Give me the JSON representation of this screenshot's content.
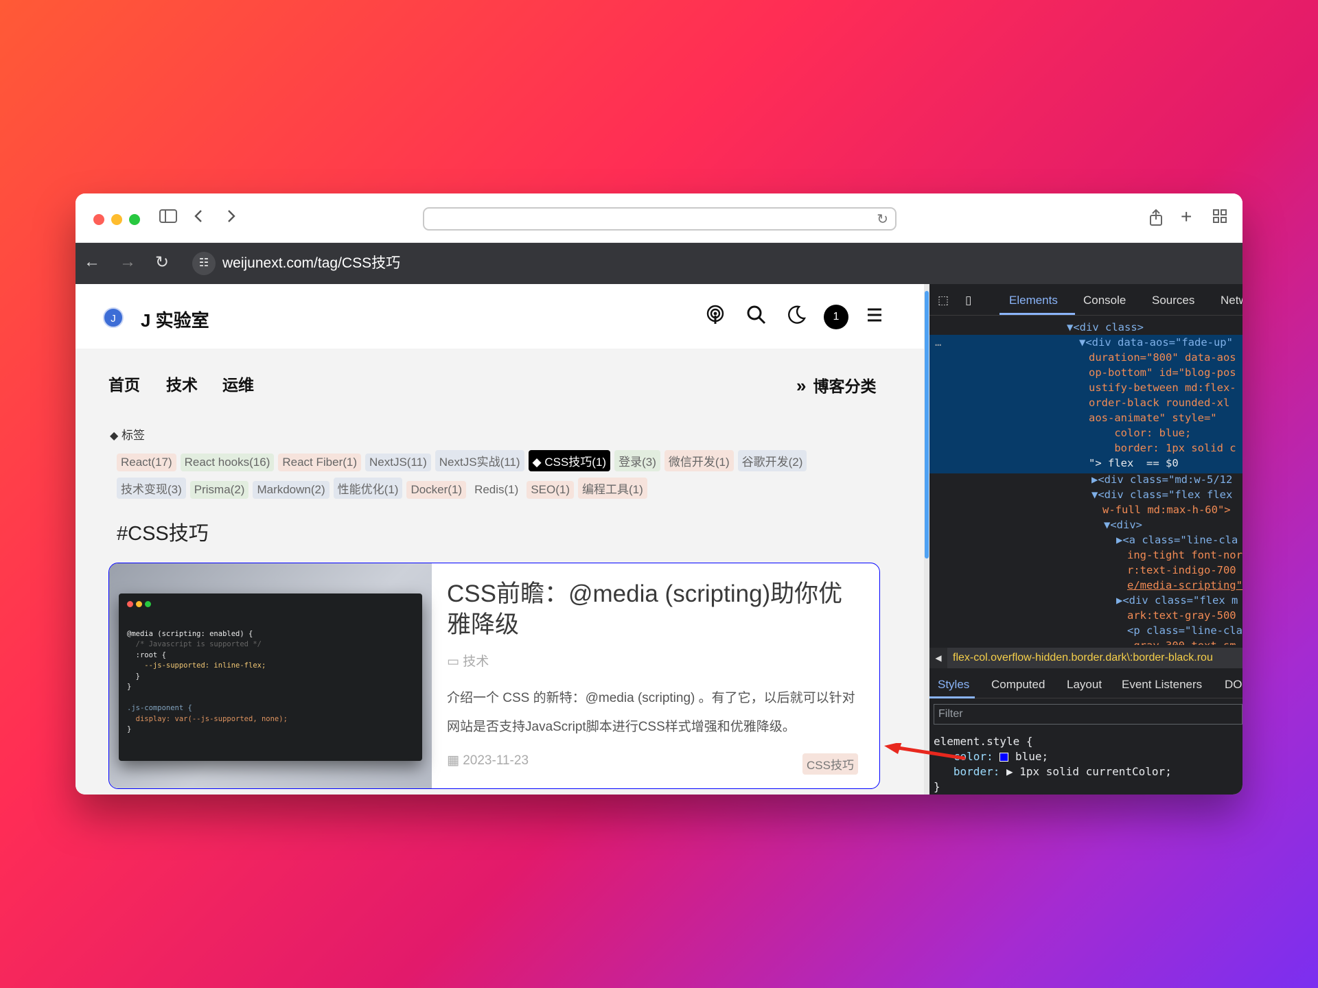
{
  "browser": {
    "url": "weijunext.com/tag/CSS技巧"
  },
  "site": {
    "logo_letter": "J",
    "title": "J 实验室",
    "badge": "1",
    "menu": [
      "首页",
      "技术",
      "运维"
    ],
    "category_link": "博客分类",
    "tag_label": "标签",
    "tags": [
      "React(17)",
      "React hooks(16)",
      "React Fiber(1)",
      "NextJS(11)",
      "NextJS实战(11)",
      "CSS技巧(1)",
      "登录(3)",
      "微信开发(1)",
      "谷歌开发(2)",
      "技术变现(3)",
      "Prisma(2)",
      "Markdown(2)",
      "性能优化(1)",
      "Docker(1)",
      "Redis(1)",
      "SEO(1)",
      "编程工具(1)"
    ],
    "active_tag": "CSS技巧(1)",
    "tag_heading": "#CSS技巧"
  },
  "post": {
    "title": "CSS前瞻：@media (scripting)助你优雅降级",
    "category": "技术",
    "description": "介绍一个 CSS 的新特：@media (scripting) 。有了它，以后就可以针对网站是否支持JavaScript脚本进行CSS样式增强和优雅降级。",
    "date": "2023-11-23",
    "tag": "CSS技巧",
    "code_lines": [
      "@media (scripting: enabled) {",
      "  /* Javascript is supported */",
      "  :root {",
      "    --js-supported: inline-flex;",
      "  }",
      "}",
      "",
      ".js-component {",
      "  display: var(--js-supported, none);",
      "}"
    ]
  },
  "devtools": {
    "tabs": [
      "Elements",
      "Console",
      "Sources",
      "Network"
    ],
    "active_tab": "Elements",
    "dom_lines": [
      "<div class>",
      "<div data-aos=\"fade-up\"",
      "duration=\"800\" data-aos",
      "op-bottom\" id=\"blog-pos",
      "ustify-between md:flex-",
      "order-black rounded-xl",
      "aos-animate\" style=\"",
      "    color: blue;",
      "    border: 1px solid c",
      "\"> flex  == $0",
      "<div class=\"md:w-5/12",
      "<div class=\"flex flex",
      "w-full md:max-h-60\">",
      "<div>",
      "<a class=\"line-cla",
      "ing-tight font-nor",
      "r:text-indigo-700",
      "e/media-scripting\"",
      "<div class=\"flex m",
      "ark:text-gray-500",
      "<p class=\"line-cla",
      "-gray-300 text-sm"
    ],
    "breadcrumb": "flex-col.overflow-hidden.border.dark\\:border-black.rou",
    "sub_tabs": [
      "Styles",
      "Computed",
      "Layout",
      "Event Listeners",
      "DOM"
    ],
    "active_sub_tab": "Styles",
    "filter_placeholder": "Filter",
    "styles": {
      "selector": "element.style {",
      "color_prop": "color:",
      "color_val": "blue;",
      "border_prop": "border:",
      "border_val": "1px solid currentColor;",
      "close": "}"
    }
  },
  "colors": {
    "card_border": "#0000ff",
    "devtools_accent": "#8ab4f8",
    "annotation_arrow": "#e8281e"
  }
}
